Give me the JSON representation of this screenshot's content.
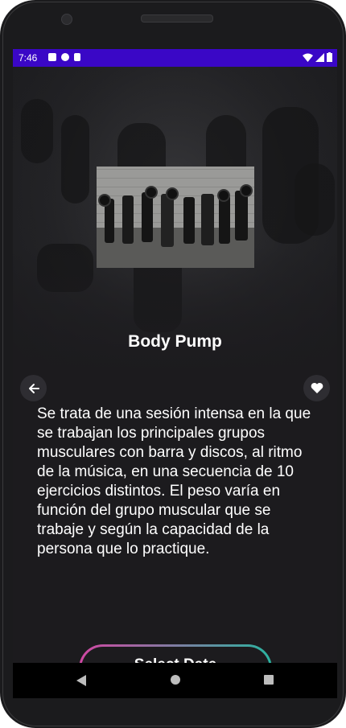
{
  "status_bar": {
    "time": "7:46",
    "left_icons": [
      "notification-a-icon",
      "notification-f-icon",
      "sd-card-icon"
    ],
    "right_icons": [
      "wifi-icon",
      "signal-icon",
      "battery-icon"
    ],
    "color": "#3a07c6"
  },
  "class_detail": {
    "title": "Body Pump",
    "description": "Se trata de una sesión intensa en la que se trabajan los principales grupos musculares con barra y discos, al ritmo de la música, en una secuencia de 10 ejercicios distintos. El peso varía en función del grupo muscular que se trabaje y según la capacidad de la persona que lo practique.",
    "select_date_label": "Select Date"
  },
  "actions": {
    "back_icon": "arrow-left-icon",
    "favorite_icon": "heart-icon"
  },
  "nav_bar": {
    "icons": [
      "back-triangle-icon",
      "home-circle-icon",
      "recents-square-icon"
    ]
  },
  "colors": {
    "background": "#1c1b1e",
    "button_gradient_start": "#d147a3",
    "button_gradient_end": "#2bb3a0"
  }
}
